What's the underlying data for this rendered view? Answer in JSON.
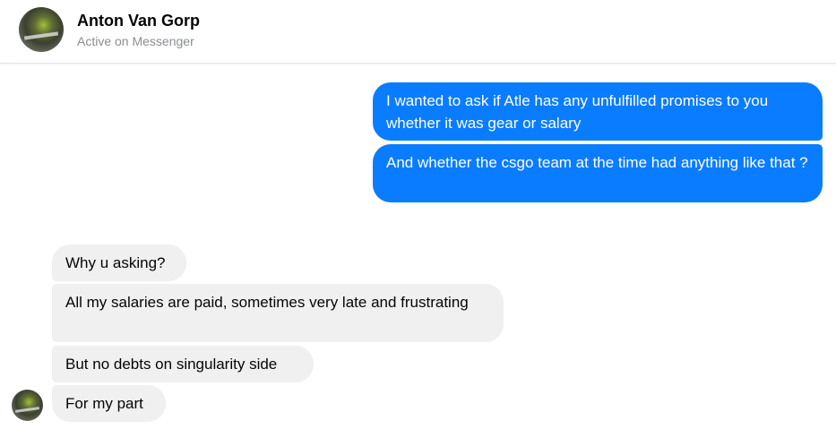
{
  "header": {
    "name": "Anton Van Gorp",
    "status": "Active on Messenger"
  },
  "messages": {
    "outgoing": [
      {
        "text": "I wanted to ask if Atle has any unfulfilled promises to you whether it was gear or salary"
      },
      {
        "text": "And whether the csgo team at the time had anything like that ?"
      }
    ],
    "incoming": [
      {
        "text": "Why u asking?"
      },
      {
        "text": "All my salaries are paid, sometimes very late and frustrating"
      },
      {
        "text": "But no debts on singularity side"
      },
      {
        "text": "For my part"
      }
    ]
  },
  "colors": {
    "outgoing_bubble": "#0a7cff",
    "incoming_bubble": "#f0f0f0"
  }
}
